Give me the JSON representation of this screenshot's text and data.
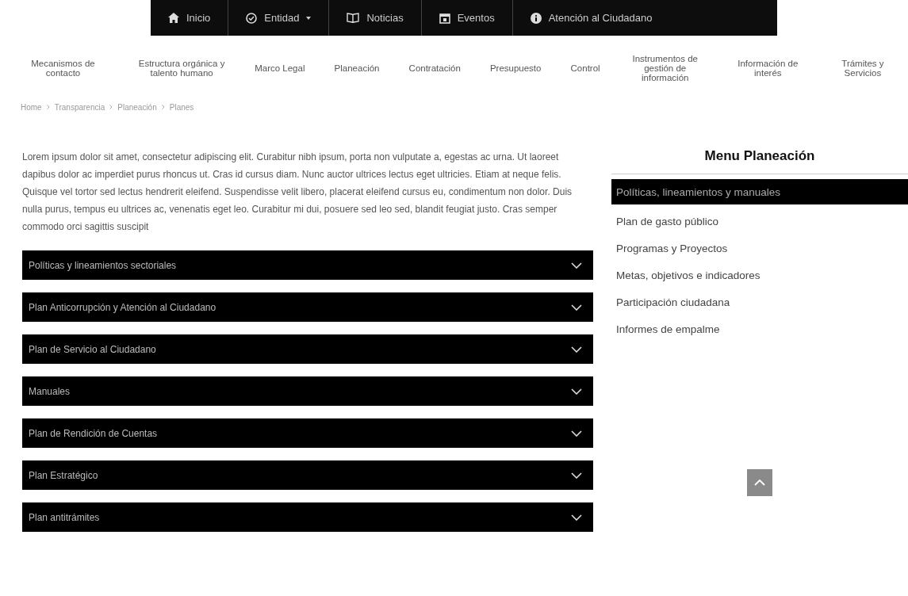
{
  "top_nav": [
    {
      "label": "Inicio",
      "kind": "home",
      "dropdown": false
    },
    {
      "label": "Entidad",
      "kind": "check",
      "dropdown": true
    },
    {
      "label": "Noticias",
      "kind": "book",
      "dropdown": false
    },
    {
      "label": "Eventos",
      "kind": "calendar",
      "dropdown": false
    },
    {
      "label": "Atención al Ciudadano",
      "kind": "info",
      "dropdown": false
    }
  ],
  "main_nav": [
    "Mecanismos de contacto",
    "Estructura orgánica y talento humano",
    "Marco Legal",
    "Planeación",
    "Contratación",
    "Presupuesto",
    "Control",
    "Instrumentos de gestión de información",
    "Información de interés",
    "Trámites y Servicios"
  ],
  "breadcrumb": [
    "Home",
    "Transparencia",
    "Planeación",
    "Planes"
  ],
  "intro": "Lorem ipsum dolor sit amet, consectetur adipiscing elit. Curabitur nibh ipsum, porta non vulputate a, egestas ac urna. Ut laoreet dapibus dolor ac imperdiet purus rhoncus ut. Cras id cursus diam. Nunc auctor ultrices lectus eget ultricies. Etiam at neque felis. Quisque vel tortor sed lectus hendrerit eleifend. Suspendisse velit libero, placerat eleifend cursus eu, condimentum non dolor. Duis nulla purus, tempus eu ultrices ac, venenatis eget leo. Curabitur mi dui, posuere sed leo sed, blandit feugiat justo. Cras semper commodo orci sagittis suscipit",
  "accordion": [
    {
      "title": "Políticas y lineamientos sectoriales",
      "expanded": false
    },
    {
      "title": "Plan Anticorrupción y Atención al Ciudadano",
      "expanded": false
    },
    {
      "title": "Plan de Servicio al Ciudadano",
      "expanded": false
    },
    {
      "title": "Manuales",
      "expanded": false
    },
    {
      "title": "Plan de Rendición de Cuentas",
      "expanded": false
    },
    {
      "title": "Plan Estratégico",
      "expanded": false
    },
    {
      "title": "Plan antitrámites",
      "expanded": false
    }
  ],
  "sidebar": {
    "title": "Menu Planeación",
    "items": [
      {
        "label": "Políticas, lineamientos y manuales",
        "selected": true
      },
      {
        "label": "Plan de gasto público",
        "selected": false
      },
      {
        "label": "Programas y Proyectos",
        "selected": false
      },
      {
        "label": "Metas, objetivos e indicadores",
        "selected": false
      },
      {
        "label": "Participación ciudadana",
        "selected": false
      },
      {
        "label": "Informes de empalme",
        "selected": false
      }
    ]
  }
}
